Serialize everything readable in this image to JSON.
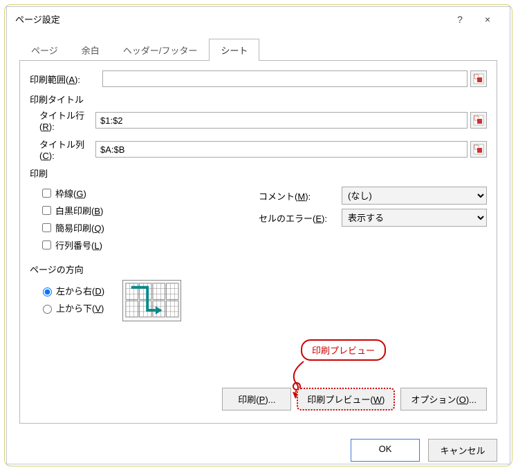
{
  "dialog": {
    "title": "ページ設定",
    "help_tooltip": "?",
    "close_tooltip": "×"
  },
  "tabs": {
    "page": "ページ",
    "margins": "余白",
    "headerfooter": "ヘッダー/フッター",
    "sheet": "シート"
  },
  "labels": {
    "print_area": "印刷範囲(A):",
    "print_titles": "印刷タイトル",
    "title_rows": "タイトル行(R):",
    "title_cols": "タイトル列(C):",
    "print_section": "印刷",
    "gridlines": "枠線(G)",
    "bw": "白黒印刷(B)",
    "draft": "簡易印刷(Q)",
    "rowcolnum": "行列番号(L)",
    "comments": "コメント(M):",
    "cellerrors": "セルのエラー(E):",
    "page_order": "ページの方向",
    "ltr": "左から右(D)",
    "ttb": "上から下(V)"
  },
  "values": {
    "print_area": "",
    "title_rows": "$1:$2",
    "title_cols": "$A:$B"
  },
  "options": {
    "comments_selected": "(なし)",
    "cellerrors_selected": "表示する"
  },
  "buttons": {
    "print": "印刷(P)...",
    "preview": "印刷プレビュー(W)",
    "options": "オプション(O)...",
    "ok": "OK",
    "cancel": "キャンセル"
  },
  "callout": {
    "text": "印刷プレビュー"
  }
}
